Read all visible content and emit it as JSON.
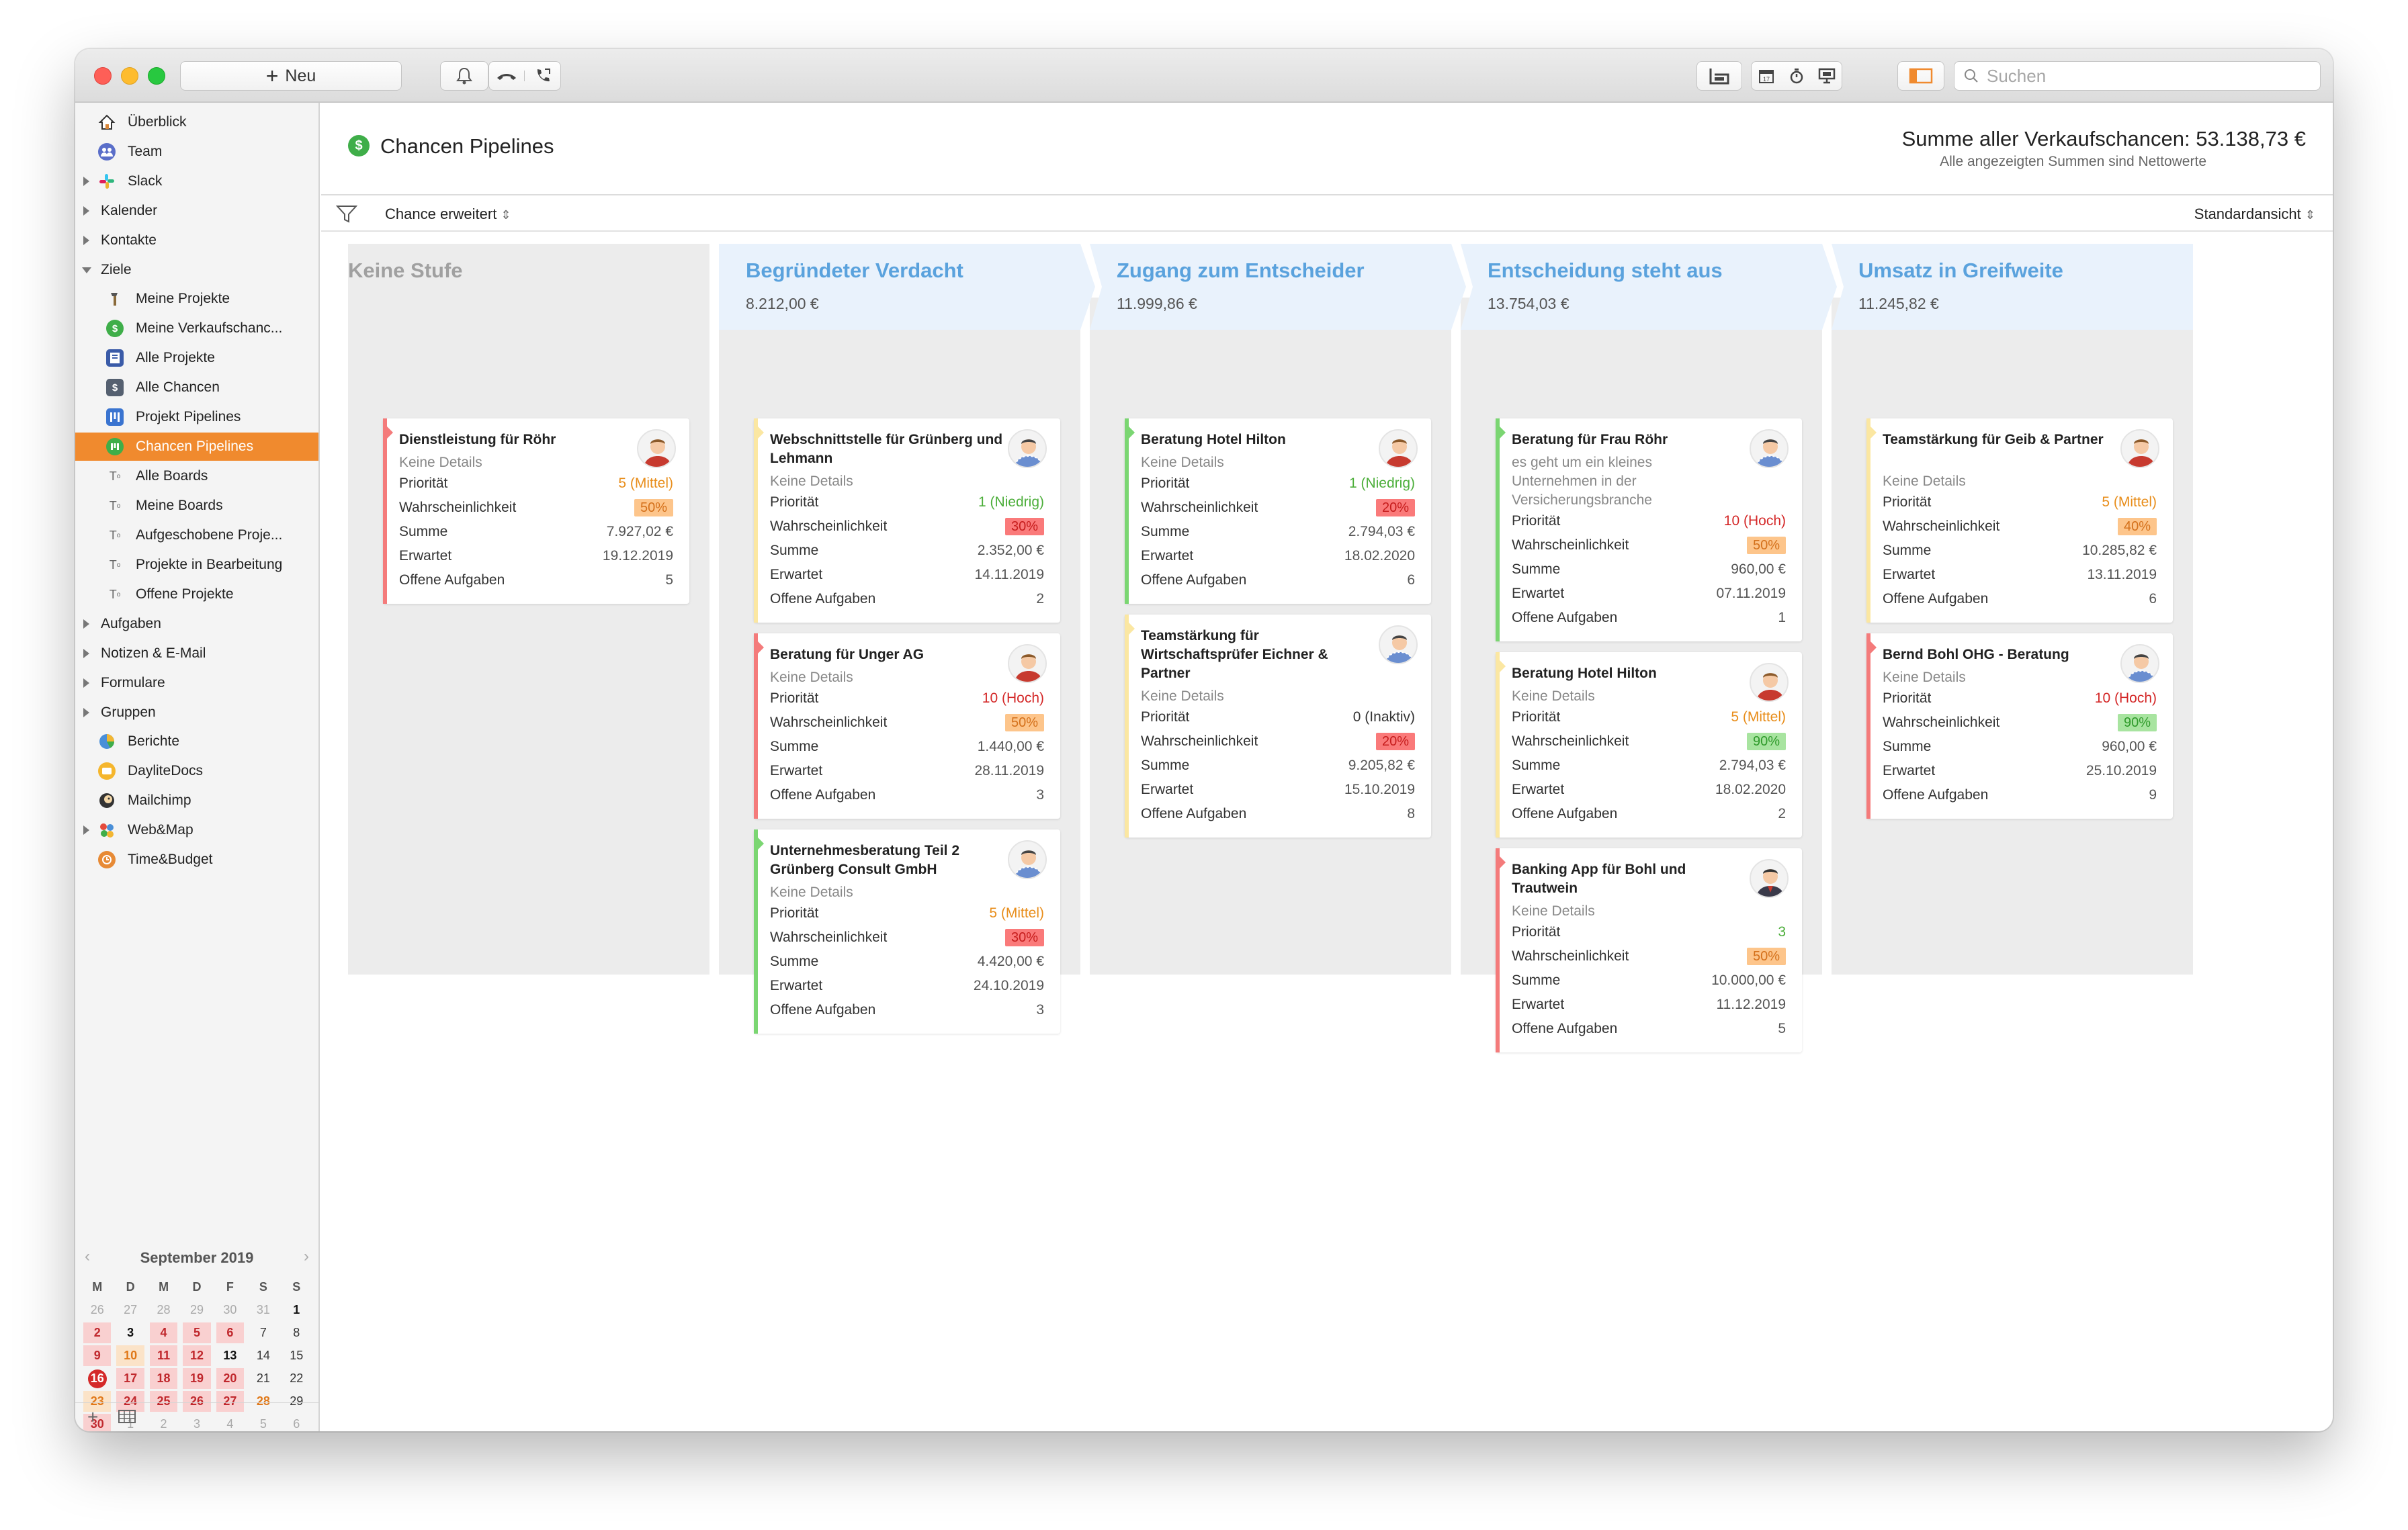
{
  "toolbar": {
    "new_label": "Neu",
    "search_placeholder": "Suchen"
  },
  "sidebar": {
    "items": [
      {
        "label": "Überblick",
        "icon": "home-icon"
      },
      {
        "label": "Team",
        "icon": "team-icon"
      },
      {
        "label": "Slack",
        "icon": "slack-icon"
      },
      {
        "label": "Kalender"
      },
      {
        "label": "Kontakte"
      },
      {
        "label": "Ziele"
      },
      {
        "label": "Meine Projekte",
        "icon": "hammer-icon"
      },
      {
        "label": "Meine Verkaufschanc...",
        "icon": "dollar-icon"
      },
      {
        "label": "Alle Projekte",
        "icon": "folder-icon"
      },
      {
        "label": "Alle Chancen",
        "icon": "dollar-doc-icon"
      },
      {
        "label": "Projekt Pipelines",
        "icon": "pipeline-icon"
      },
      {
        "label": "Chancen Pipelines",
        "icon": "pipeline-dollar-icon"
      },
      {
        "label": "Alle Boards",
        "icon": "board-icon"
      },
      {
        "label": "Meine Boards",
        "icon": "board-icon"
      },
      {
        "label": "Aufgeschobene Proje...",
        "icon": "board-icon"
      },
      {
        "label": "Projekte in Bearbeitung",
        "icon": "board-icon"
      },
      {
        "label": "Offene Projekte",
        "icon": "board-icon"
      },
      {
        "label": "Aufgaben"
      },
      {
        "label": "Notizen & E-Mail"
      },
      {
        "label": "Formulare"
      },
      {
        "label": "Gruppen"
      },
      {
        "label": "Berichte",
        "icon": "pie-chart-icon"
      },
      {
        "label": "DayliteDocs",
        "icon": "docs-icon"
      },
      {
        "label": "Mailchimp",
        "icon": "mailchimp-icon"
      },
      {
        "label": "Web&Map",
        "icon": "web-map-icon"
      },
      {
        "label": "Time&Budget",
        "icon": "clock-icon"
      }
    ]
  },
  "calendar": {
    "month": "September 2019",
    "weekdays": [
      "M",
      "D",
      "M",
      "D",
      "F",
      "S",
      "S"
    ],
    "weeks": [
      [
        "26",
        "27",
        "28",
        "29",
        "30",
        "31",
        "1"
      ],
      [
        "2",
        "3",
        "4",
        "5",
        "6",
        "7",
        "8"
      ],
      [
        "9",
        "10",
        "11",
        "12",
        "13",
        "14",
        "15"
      ],
      [
        "16",
        "17",
        "18",
        "19",
        "20",
        "21",
        "22"
      ],
      [
        "23",
        "24",
        "25",
        "26",
        "27",
        "28",
        "29"
      ],
      [
        "30",
        "1",
        "2",
        "3",
        "4",
        "5",
        "6"
      ]
    ]
  },
  "header": {
    "title": "Chancen Pipelines",
    "total": "Summe aller Verkaufschancen: 53.138,73 €",
    "note": "Alle angezeigten Summen sind Nettowerte"
  },
  "filterbar": {
    "filter": "Chance erweitert",
    "view": "Standardansicht"
  },
  "labels": {
    "prioritaet": "Priorität",
    "wahrscheinlichkeit": "Wahrscheinlichkeit",
    "summe": "Summe",
    "erwartet": "Erwartet",
    "aufgaben": "Offene Aufgaben"
  },
  "no_stage": {
    "name": "Keine Stufe",
    "cards": [
      {
        "title": "Dienstleistung für Röhr",
        "details": "Keine Details",
        "priority": "5 (Mittel)",
        "probability": "50%",
        "sum": "7.927,02 €",
        "expected": "19.12.2019",
        "tasks": "5"
      }
    ]
  },
  "stages": [
    {
      "name": "Begründeter Verdacht",
      "sum": "8.212,00 €",
      "cards": [
        {
          "title": "Webschnittstelle für Grünberg und Lehmann",
          "details": "Keine Details",
          "priority": "1 (Niedrig)",
          "probability": "30%",
          "sum": "2.352,00 €",
          "expected": "14.11.2019",
          "tasks": "2"
        },
        {
          "title": "Beratung für Unger AG",
          "details": "Keine Details",
          "priority": "10 (Hoch)",
          "probability": "50%",
          "sum": "1.440,00 €",
          "expected": "28.11.2019",
          "tasks": "3"
        },
        {
          "title": "Unternehmesberatung Teil 2 Grünberg Consult GmbH",
          "details": "Keine Details",
          "priority": "5 (Mittel)",
          "probability": "30%",
          "sum": "4.420,00 €",
          "expected": "24.10.2019",
          "tasks": "3"
        }
      ]
    },
    {
      "name": "Zugang zum Entscheider",
      "sum": "11.999,86 €",
      "cards": [
        {
          "title": "Beratung Hotel Hilton",
          "details": "Keine Details",
          "priority": "1 (Niedrig)",
          "probability": "20%",
          "sum": "2.794,03 €",
          "expected": "18.02.2020",
          "tasks": "6"
        },
        {
          "title": "Teamstärkung für Wirtschaftsprüfer Eichner & Partner",
          "details": "Keine Details",
          "priority": "0 (Inaktiv)",
          "probability": "20%",
          "sum": "9.205,82 €",
          "expected": "15.10.2019",
          "tasks": "8"
        }
      ]
    },
    {
      "name": "Entscheidung steht aus",
      "sum": "13.754,03 €",
      "cards": [
        {
          "title": "Beratung für Frau Röhr",
          "details": "es geht um ein kleines Unternehmen in der Versicherungsbranche",
          "priority": "10 (Hoch)",
          "probability": "50%",
          "sum": "960,00 €",
          "expected": "07.11.2019",
          "tasks": "1"
        },
        {
          "title": "Beratung Hotel Hilton",
          "details": "Keine Details",
          "priority": "5 (Mittel)",
          "probability": "90%",
          "sum": "2.794,03 €",
          "expected": "18.02.2020",
          "tasks": "2"
        },
        {
          "title": "Banking App für Bohl und Trautwein",
          "details": "Keine Details",
          "priority": "3",
          "probability": "50%",
          "sum": "10.000,00 €",
          "expected": "11.12.2019",
          "tasks": "5"
        }
      ]
    },
    {
      "name": "Umsatz in Greifweite",
      "sum": "11.245,82 €",
      "cards": [
        {
          "title": "Teamstärkung für Geib & Partner",
          "details": "Keine Details",
          "priority": "5 (Mittel)",
          "probability": "40%",
          "sum": "10.285,82 €",
          "expected": "13.11.2019",
          "tasks": "6"
        },
        {
          "title": "Bernd Bohl OHG - Beratung",
          "details": "Keine Details",
          "priority": "10 (Hoch)",
          "probability": "90%",
          "sum": "960,00 €",
          "expected": "25.10.2019",
          "tasks": "9"
        }
      ]
    }
  ],
  "colors": {
    "accent": "#f08a2e",
    "stage_header_bg": "#e9f2fc",
    "stage_title": "#5aa2dd",
    "column_bg": "#ececec",
    "bar_red": "#f47b7b",
    "bar_green": "#7bd672",
    "bar_yellow": "#fbe7a2"
  }
}
